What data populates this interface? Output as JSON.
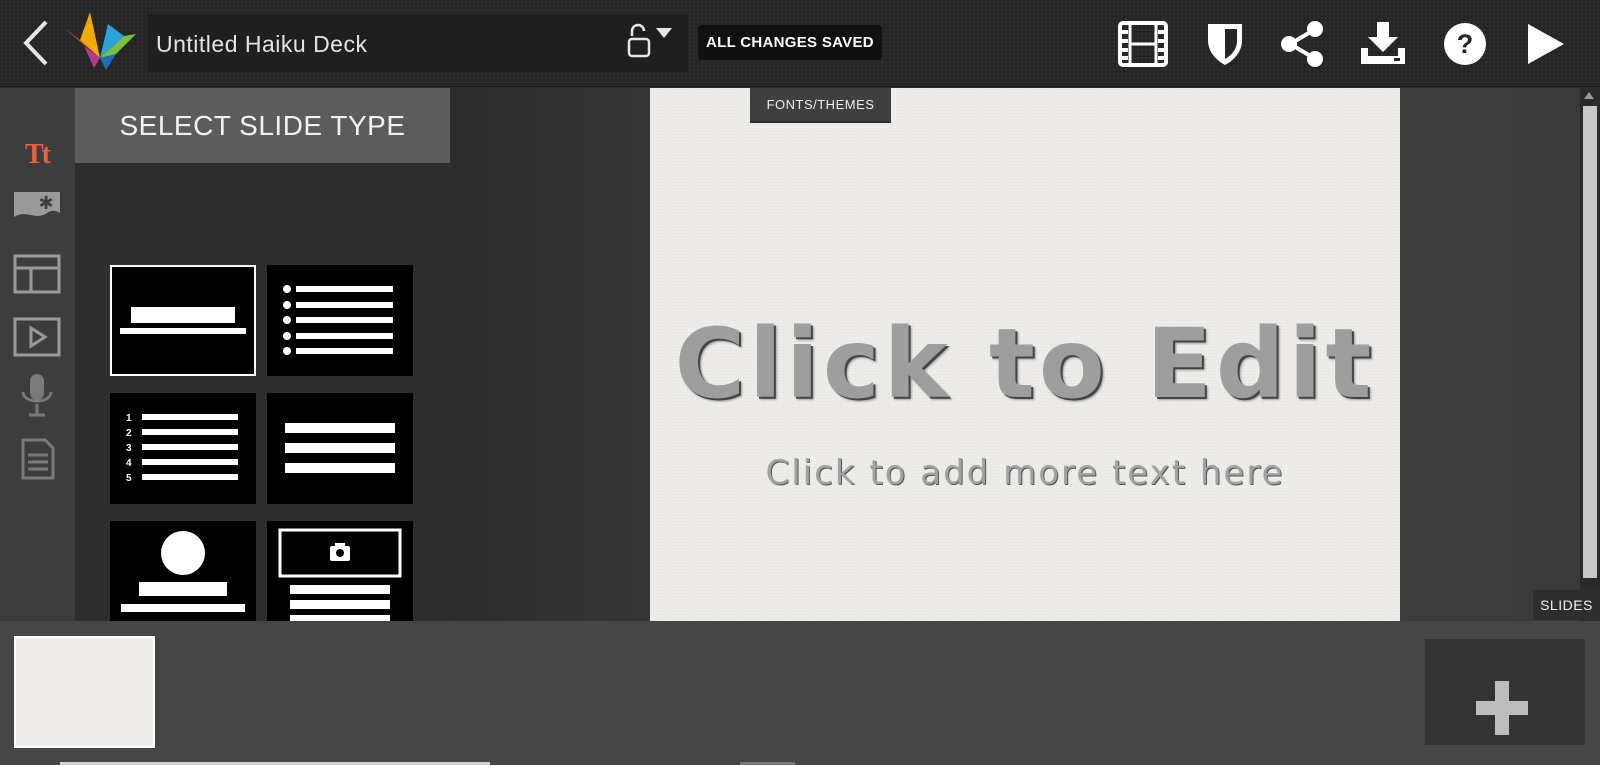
{
  "header": {
    "deck_title": "Untitled Haiku Deck",
    "save_status": "ALL CHANGES SAVED"
  },
  "toolbar": {
    "icons": [
      "filmstrip-icon",
      "shield-icon",
      "share-icon",
      "download-icon",
      "help-icon",
      "play-icon"
    ]
  },
  "rail": {
    "items": [
      "text-tt-icon",
      "image-icon",
      "layout-icon",
      "video-icon",
      "microphone-icon",
      "notes-icon"
    ],
    "active_color": "#e8623c"
  },
  "panel": {
    "title": "SELECT SLIDE TYPE",
    "tiles": [
      "title",
      "bullet-list",
      "numbered-list",
      "lines",
      "profile",
      "photo-caption"
    ],
    "numbered_list_digits": [
      "1",
      "2",
      "3",
      "4",
      "5"
    ]
  },
  "slide": {
    "fonts_tab": "FONTS/THEMES",
    "title": "Click to Edit",
    "subtitle": "Click to add more text here"
  },
  "slides_label": "SLIDES"
}
